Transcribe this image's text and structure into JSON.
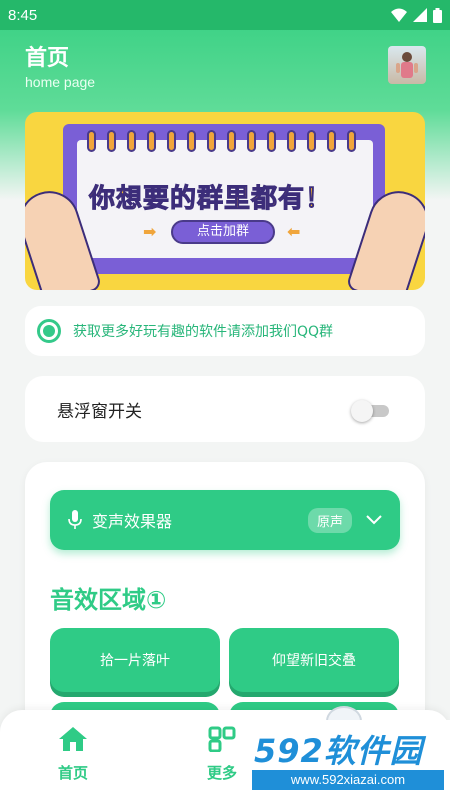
{
  "status_bar": {
    "time": "8:45"
  },
  "header": {
    "title": "首页",
    "subtitle": "home page"
  },
  "banner": {
    "headline": "你想要的群里都有！",
    "button_label": "点击加群"
  },
  "notice": {
    "text": "获取更多好玩有趣的软件请添加我们QQ群"
  },
  "floating_window": {
    "label": "悬浮窗开关",
    "enabled": false
  },
  "voice_changer": {
    "title": "变声效果器",
    "badge": "原声"
  },
  "effects": {
    "section_title": "音效区域①",
    "buttons": [
      "拾一片落叶",
      "仰望新旧交叠"
    ]
  },
  "bottom_nav": {
    "items": [
      {
        "label": "首页",
        "icon": "home-icon"
      },
      {
        "label": "更多",
        "icon": "apps-icon"
      }
    ]
  },
  "watermark": {
    "brand": "592软件园",
    "url": "www.592xiazai.com"
  },
  "colors": {
    "accent": "#2fcb86",
    "banner_bg": "#f9d640",
    "board": "#7a5fd6"
  }
}
